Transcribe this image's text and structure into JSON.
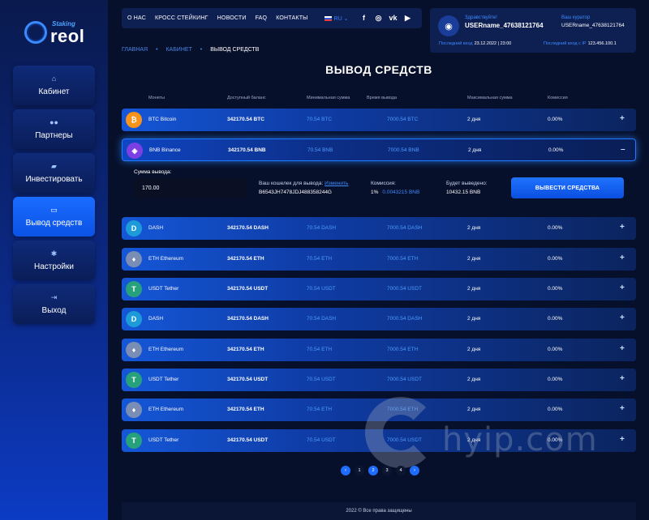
{
  "brand": {
    "small": "Staking",
    "big": "reol"
  },
  "sidebar": {
    "items": [
      {
        "label": "Кабинет",
        "icon": "home-icon",
        "glyph": "⌂"
      },
      {
        "label": "Партнеры",
        "icon": "users-icon",
        "glyph": "●●"
      },
      {
        "label": "Инвестировать",
        "icon": "stack-icon",
        "glyph": "▰"
      },
      {
        "label": "Вывод средств",
        "icon": "wallet-icon",
        "glyph": "▭"
      },
      {
        "label": "Настройки",
        "icon": "gear-icon",
        "glyph": "✱"
      },
      {
        "label": "Выход",
        "icon": "logout-icon",
        "glyph": "⇥"
      }
    ]
  },
  "topnav": {
    "links": [
      "О НАС",
      "КРОСС СТЕЙКИНГ",
      "НОВОСТИ",
      "FAQ",
      "КОНТАКТЫ"
    ],
    "lang": "RU ⌄",
    "social": [
      "f",
      "◎",
      "vk",
      "▶"
    ]
  },
  "user": {
    "avatar_glyph": "◉",
    "hello": "Здравствуйте!",
    "username": "USERname_47638121764",
    "curator_label": "Ваш куратор",
    "curator": "USERname_47638121764",
    "last_login_label": "Последний вход",
    "last_login": "23.12.2022 | 23:00",
    "last_ip_label": "Последний вход с IP",
    "last_ip": "123.456.100.1"
  },
  "breadcrumb": {
    "home": "ГЛАВНАЯ",
    "sep": "•",
    "cabinet": "КАБИНЕТ",
    "current": "ВЫВОД СРЕДСТВ"
  },
  "page_title": "ВЫВОД СРЕДСТВ",
  "table": {
    "headers": [
      "Монеты",
      "Доступный баланс",
      "Минимальная сумма",
      "Время вывода",
      "Максимальная сумма",
      "Комиссия"
    ],
    "rows": [
      {
        "coin": "BTC Bitcoin",
        "glyph": "₿",
        "color": "#f7931a",
        "balance": "342170.54 BTC",
        "min": "70.54 BTC",
        "time": "7000.54 BTC",
        "max": "2 дня",
        "fee": "0.00%",
        "toggle": "+"
      },
      {
        "coin": "BNB Binance",
        "glyph": "◈",
        "color": "#7b3fe4",
        "balance": "342170.54 BNB",
        "min": "70.54 BNB",
        "time": "7000.54 BNB",
        "max": "2 дня",
        "fee": "0.00%",
        "toggle": "–"
      },
      {
        "coin": "DASH",
        "glyph": "D",
        "color": "#1c9bd8",
        "balance": "342170.54 DASH",
        "min": "70.54 DASH",
        "time": "7000.54 DASH",
        "max": "2 дня",
        "fee": "0.00%",
        "toggle": "+"
      },
      {
        "coin": "ETH Ethereum",
        "glyph": "♦",
        "color": "#7a8db5",
        "balance": "342170.54 ETH",
        "min": "70.54 ETH",
        "time": "7000.54 ETH",
        "max": "2 дня",
        "fee": "0.00%",
        "toggle": "+"
      },
      {
        "coin": "USDT Tether",
        "glyph": "T",
        "color": "#26a17b",
        "balance": "342170.54 USDT",
        "min": "70.54 USDT",
        "time": "7000.54 USDT",
        "max": "2 дня",
        "fee": "0.00%",
        "toggle": "+"
      },
      {
        "coin": "DASH",
        "glyph": "D",
        "color": "#1c9bd8",
        "balance": "342170.54 DASH",
        "min": "70.54 DASH",
        "time": "7000.54 DASH",
        "max": "2 дня",
        "fee": "0.00%",
        "toggle": "+"
      },
      {
        "coin": "ETH Ethereum",
        "glyph": "♦",
        "color": "#7a8db5",
        "balance": "342170.54 ETH",
        "min": "70.54 ETH",
        "time": "7000.54 ETH",
        "max": "2 дня",
        "fee": "0.00%",
        "toggle": "+"
      },
      {
        "coin": "USDT Tether",
        "glyph": "T",
        "color": "#26a17b",
        "balance": "342170.54 USDT",
        "min": "70.54 USDT",
        "time": "7000.54 USDT",
        "max": "2 дня",
        "fee": "0.00%",
        "toggle": "+"
      },
      {
        "coin": "ETH Ethereum",
        "glyph": "♦",
        "color": "#7a8db5",
        "balance": "342170.54 ETH",
        "min": "70.54 ETH",
        "time": "7000.54 ETH",
        "max": "2 дня",
        "fee": "0.00%",
        "toggle": "+"
      },
      {
        "coin": "USDT Tether",
        "glyph": "T",
        "color": "#26a17b",
        "balance": "342170.54 USDT",
        "min": "70.54 USDT",
        "time": "7000.54 USDT",
        "max": "2 дня",
        "fee": "0.00%",
        "toggle": "+"
      }
    ]
  },
  "withdraw": {
    "amount_label": "Сумма вывода:",
    "amount_value": "170.00",
    "wallet_label": "Ваш кошелек для вывода:",
    "wallet_change": "Изменить",
    "wallet_value": "B6543JH7478JDJ488358244G",
    "fee_label": "Комиссия:",
    "fee_percent": "1%",
    "fee_amount": "0.0043215 BNB",
    "result_label": "Будет выведено:",
    "result_value": "10432.15 BNB",
    "button": "ВЫВЕСТИ СРЕДСТВА"
  },
  "pagination": {
    "prev": "‹",
    "pages": [
      "1",
      "2",
      "3",
      "4"
    ],
    "current": "2",
    "next": "›"
  },
  "watermark": "hyip.com",
  "footer": "2022 © Все права защищены"
}
